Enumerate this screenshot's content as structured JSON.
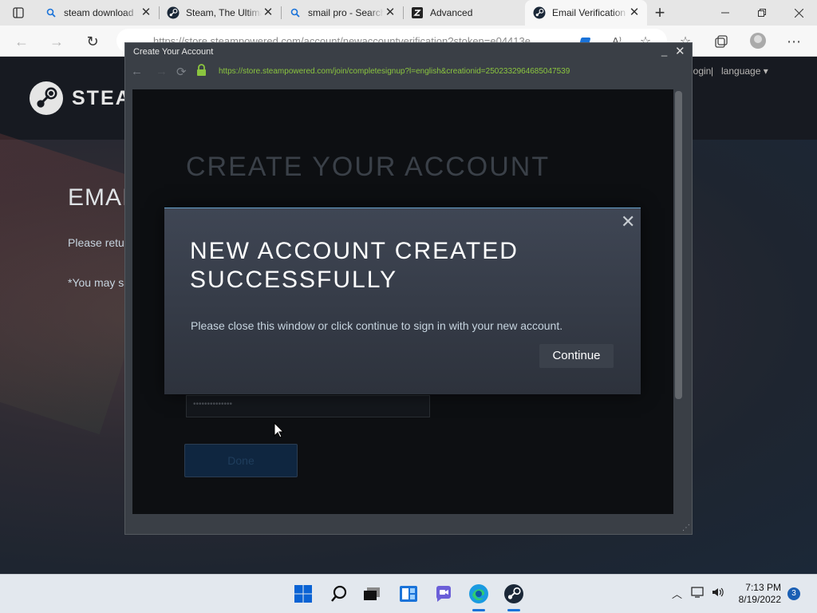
{
  "browser": {
    "tabs": [
      {
        "title": "steam download",
        "icon": "search-icon"
      },
      {
        "title": "Steam, The Ultimate",
        "icon": "steam-icon"
      },
      {
        "title": "smail pro - Search",
        "icon": "search-icon"
      },
      {
        "title": "Advanced",
        "icon": "site-icon"
      },
      {
        "title": "Email Verification",
        "icon": "steam-icon",
        "active": true
      }
    ],
    "address_url": "https://store.steampowered.com/account/newaccountverification?stoken=e04413e"
  },
  "steam_page": {
    "logo_text": "STEAM",
    "login_link": "login",
    "separator": "|",
    "language_link": "language",
    "heading": "EMAIL VERIFIED",
    "text1": "Please return to the Steam client to continue.",
    "text2": "*You may safely close this window."
  },
  "popup": {
    "title": "Create Your Account",
    "url": "https://store.steampowered.com/join/completesignup?l=english&creationid=2502332964685047539",
    "page_heading": "CREATE YOUR ACCOUNT",
    "password_mask": "••••••••••••••",
    "done_label": "Done"
  },
  "modal": {
    "heading": "NEW ACCOUNT CREATED SUCCESSFULLY",
    "message": "Please close this window or click continue to sign in with your new account.",
    "continue_label": "Continue",
    "close_glyph": "✕"
  },
  "taskbar": {
    "time": "7:13 PM",
    "date": "8/19/2022",
    "notification_count": "3"
  },
  "colors": {
    "steam_bg": "#1b2838",
    "url_green": "#8bc53f",
    "accent_blue": "#68a4cf"
  }
}
